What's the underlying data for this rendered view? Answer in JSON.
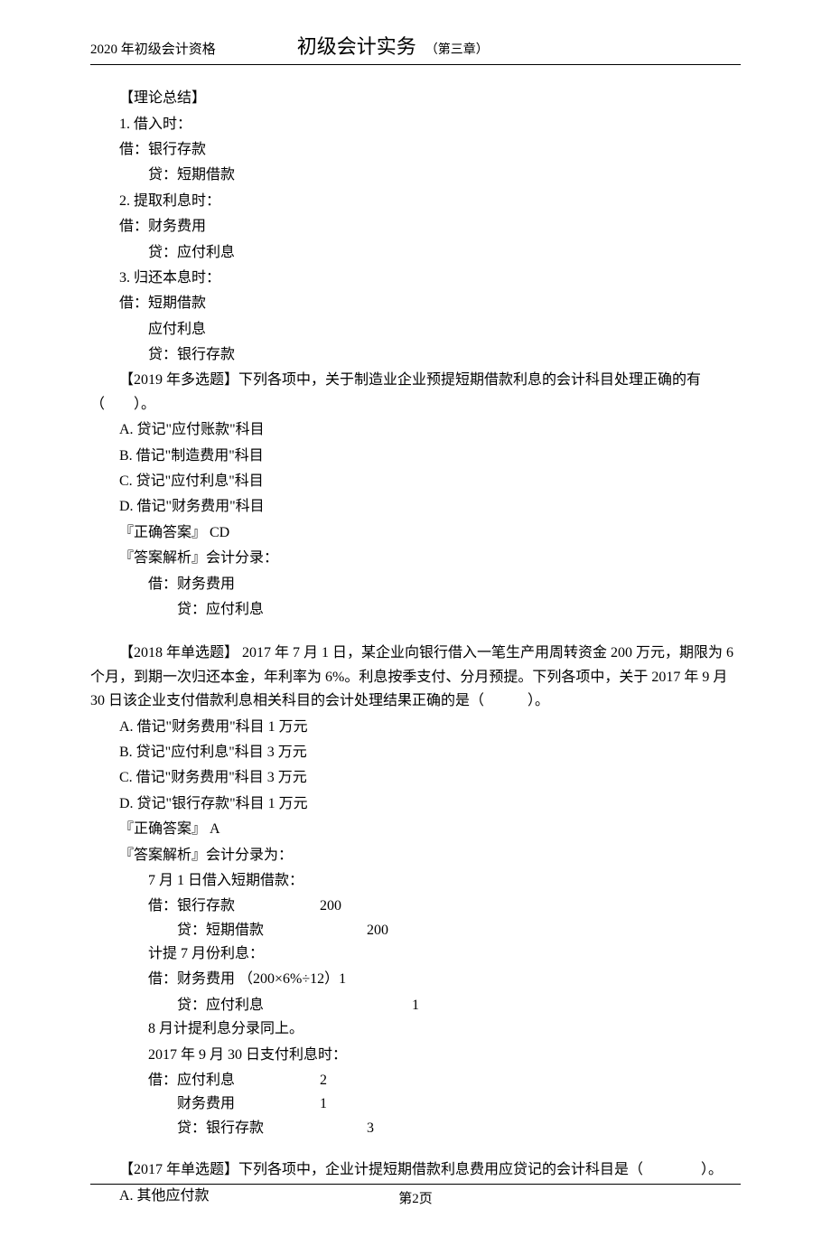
{
  "header": {
    "left": "2020 年初级会计资格",
    "title": "初级会计实务",
    "chapter": "（第三章）"
  },
  "summary": {
    "head": "【理论总结】",
    "s1": "1. 借入时：",
    "s1a": "借：银行存款",
    "s1b": "贷：短期借款",
    "s2": "2. 提取利息时：",
    "s2a": "借：财务费用",
    "s2b": "贷：应付利息",
    "s3": "3. 归还本息时：",
    "s3a": "借：短期借款",
    "s3b": "应付利息",
    "s3c": "贷：银行存款"
  },
  "q1": {
    "stem": "【2019 年多选题】下列各项中，关于制造业企业预提短期借款利息的会计科目处理正确的有（　　）。",
    "A": "A. 贷记\"应付账款\"科目",
    "B": "B. 借记\"制造费用\"科目",
    "C": "C. 贷记\"应付利息\"科目",
    "D": "D. 借记\"财务费用\"科目",
    "ans": "『正确答案』   CD",
    "explHead": "『答案解析』会计分录：",
    "expl1": "借：财务费用",
    "expl2": "贷：应付利息"
  },
  "q2": {
    "stem1": "【2018 年单选题】  2017 年 7 月 1 日，某企业向银行借入一笔生产用周转资金       200 万元，期限为 6 个月，到期一次归还本金，年利率为      6%。利息按季支付、分月预提。下列各项中，关于      2017 年 9 月 30 日该企业支付借款利息相关科目的会计处理结果正确的是（　　　）。",
    "A": "A. 借记\"财务费用\"科目     1 万元",
    "B": "B. 贷记\"应付利息\"科目     3 万元",
    "C": "C. 借记\"财务费用\"科目     3 万元",
    "D": "D. 贷记\"银行存款\"科目    1 万元",
    "ans": "『正确答案』   A",
    "explHead": "『答案解析』会计分录为：",
    "e1": "7 月 1 日借入短期借款：",
    "e2l": "借：银行存款",
    "e2a": "200",
    "e3l": "贷：短期借款",
    "e3a": "200",
    "e4": "计提 7 月份利息：",
    "e5l": "借：财务费用    （200×6%÷12）1",
    "e6l": "贷：应付利息",
    "e6a": "1",
    "e7": "8 月计提利息分录同上。",
    "e8": "2017 年 9 月 30 日支付利息时：",
    "e9l": "借：应付利息",
    "e9a": "2",
    "e10l": "财务费用",
    "e10a": "1",
    "e11l": "贷：银行存款",
    "e11a": "3"
  },
  "q3": {
    "stem": "【2017 年单选题】下列各项中，企业计提短期借款利息费用应贷记的会计科目是（　　　　）。",
    "A": "A. 其他应付款"
  },
  "footer": "第2页"
}
